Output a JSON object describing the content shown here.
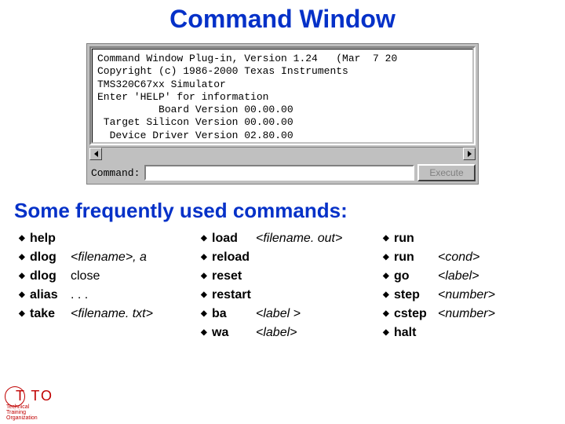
{
  "title": "Command Window",
  "window": {
    "output_lines": [
      "Command Window Plug-in, Version 1.24   (Mar  7 20",
      "Copyright (c) 1986-2000 Texas Instruments",
      "TMS320C67xx Simulator",
      "Enter 'HELP' for information",
      "          Board Version 00.00.00",
      " Target Silicon Version 00.00.00",
      "  Device Driver Version 02.80.00"
    ],
    "command_label": "Command:",
    "command_value": "",
    "execute_label": "Execute"
  },
  "freq_heading": "Some frequently used commands:",
  "col1": [
    {
      "cmd": "help",
      "arg": ""
    },
    {
      "cmd": "dlog",
      "arg": "<filename>, a"
    },
    {
      "cmd": "dlog",
      "arg": "close"
    },
    {
      "cmd": "alias",
      "arg": ". . ."
    },
    {
      "cmd": "take",
      "arg": "<filename. txt>"
    }
  ],
  "col2": [
    {
      "cmd": "load",
      "arg": "<filename. out>"
    },
    {
      "cmd": "reload",
      "arg": ""
    },
    {
      "cmd": "reset",
      "arg": ""
    },
    {
      "cmd": "restart",
      "arg": ""
    },
    {
      "cmd": "ba",
      "arg": "<label >"
    },
    {
      "cmd": "wa",
      "arg": "<label>"
    }
  ],
  "col3": [
    {
      "cmd": "run",
      "arg": ""
    },
    {
      "cmd": "run",
      "arg": "<cond>"
    },
    {
      "cmd": "go",
      "arg": "<label>"
    },
    {
      "cmd": "step",
      "arg": "<number>"
    },
    {
      "cmd": "cstep",
      "arg": "<number>"
    },
    {
      "cmd": "halt",
      "arg": ""
    }
  ],
  "tto": {
    "label": "T TO",
    "sub1": "Technical",
    "sub2": "Training",
    "sub3": "Organization"
  }
}
